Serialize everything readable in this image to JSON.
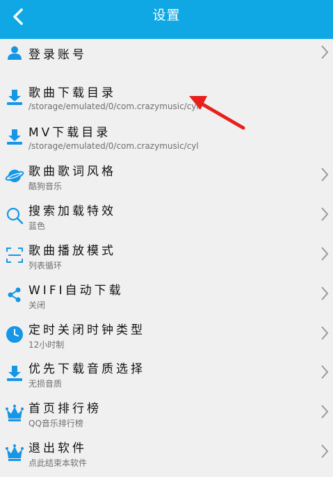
{
  "header": {
    "title": "设置",
    "back_icon": "chevron-left-icon",
    "background": "#0fa8e4"
  },
  "items": [
    {
      "title": "登录账号",
      "subtitle": "",
      "icon": "user-icon",
      "chevron": true
    },
    {
      "title": "歌曲下载目录",
      "subtitle": "/storage/emulated/0/com.crazymusic/cyl",
      "icon": "download-icon",
      "chevron": false
    },
    {
      "title": "MV下载目录",
      "subtitle": "/storage/emulated/0/com.crazymusic/cyl",
      "icon": "download-icon",
      "chevron": false
    },
    {
      "title": "歌曲歌词风格",
      "subtitle": "酷狗音乐",
      "icon": "planet-icon",
      "chevron": true
    },
    {
      "title": "搜索加载特效",
      "subtitle": "蓝色",
      "icon": "search-icon",
      "chevron": true
    },
    {
      "title": "歌曲播放模式",
      "subtitle": "列表循环",
      "icon": "scan-frame-icon",
      "chevron": true
    },
    {
      "title": "WIFI自动下载",
      "subtitle": "关闭",
      "icon": "share-icon",
      "chevron": true
    },
    {
      "title": "定时关闭时钟类型",
      "subtitle": "12小时制",
      "icon": "clock-icon",
      "chevron": true
    },
    {
      "title": "优先下载音质选择",
      "subtitle": "无损音质",
      "icon": "download-icon",
      "chevron": true
    },
    {
      "title": "首页排行榜",
      "subtitle": "QQ音乐排行榜",
      "icon": "crown-icon",
      "chevron": true
    },
    {
      "title": "退出软件",
      "subtitle": "点此结束本软件",
      "icon": "crown-icon",
      "chevron": true
    }
  ],
  "annotation": {
    "icon": "red-arrow-icon",
    "color": "#e8201c"
  },
  "colors": {
    "accent": "#0fa8e4",
    "icon_blue": "#1596e6",
    "chevron": "#999999"
  }
}
